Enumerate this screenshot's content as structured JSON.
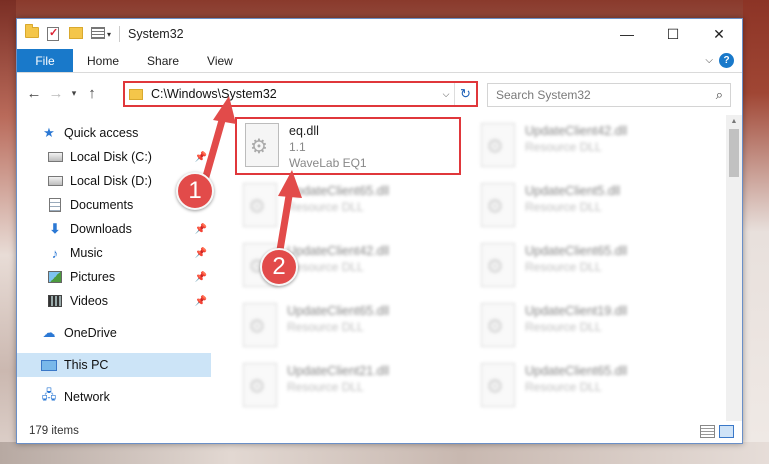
{
  "window": {
    "title": "System32",
    "controls": {
      "minimize": "—",
      "maximize": "☐",
      "close": "✕"
    }
  },
  "ribbon": {
    "file_label": "File",
    "tabs": [
      "Home",
      "Share",
      "View"
    ],
    "help_label": "?"
  },
  "nav": {
    "back_icon": "←",
    "forward_icon": "→",
    "recent_icon": "▾",
    "up_icon": "↑"
  },
  "address": {
    "path": "C:\\Windows\\System32",
    "refresh_icon": "↻",
    "dropdown_icon": "⌵"
  },
  "search": {
    "placeholder": "Search System32",
    "icon": "⌕"
  },
  "sidebar": {
    "quick_access": "Quick access",
    "items": [
      {
        "label": "Local Disk (C:)",
        "icon": "drive-icon",
        "pinned": true
      },
      {
        "label": "Local Disk (D:)",
        "icon": "drive-icon",
        "pinned": false
      },
      {
        "label": "Documents",
        "icon": "documents-icon",
        "pinned": true
      },
      {
        "label": "Downloads",
        "icon": "downloads-icon",
        "pinned": true
      },
      {
        "label": "Music",
        "icon": "music-icon",
        "pinned": true
      },
      {
        "label": "Pictures",
        "icon": "pictures-icon",
        "pinned": true
      },
      {
        "label": "Videos",
        "icon": "videos-icon",
        "pinned": true
      }
    ],
    "onedrive": "OneDrive",
    "this_pc": "This PC",
    "network": "Network",
    "pin_glyph": "📌"
  },
  "files": [
    {
      "name": "eq.dll",
      "line2": "1.1",
      "line3": "WaveLab EQ1",
      "highlighted": true
    },
    {
      "name": "UpdateClient42.dll",
      "line2": "Resource DLL"
    },
    {
      "name": "UpdateClient65.dll",
      "line2": "Resource DLL"
    },
    {
      "name": "UpdateClient5.dll",
      "line2": "Resource DLL"
    },
    {
      "name": "UpdateClient42.dll",
      "line2": "Resource DLL"
    },
    {
      "name": "UpdateClient65.dll",
      "line2": "Resource DLL"
    },
    {
      "name": "UpdateClient65.dll",
      "line2": "Resource DLL"
    },
    {
      "name": "UpdateClient19.dll",
      "line2": "Resource DLL"
    },
    {
      "name": "UpdateClient21.dll",
      "line2": "Resource DLL"
    },
    {
      "name": "UpdateClient65.dll",
      "line2": "Resource DLL"
    }
  ],
  "status": {
    "item_count": "179 items"
  },
  "annotations": {
    "step1": "1",
    "step2": "2"
  },
  "colors": {
    "accent": "#1979ca",
    "highlight": "#e0373b",
    "badge": "#e24b4a"
  }
}
